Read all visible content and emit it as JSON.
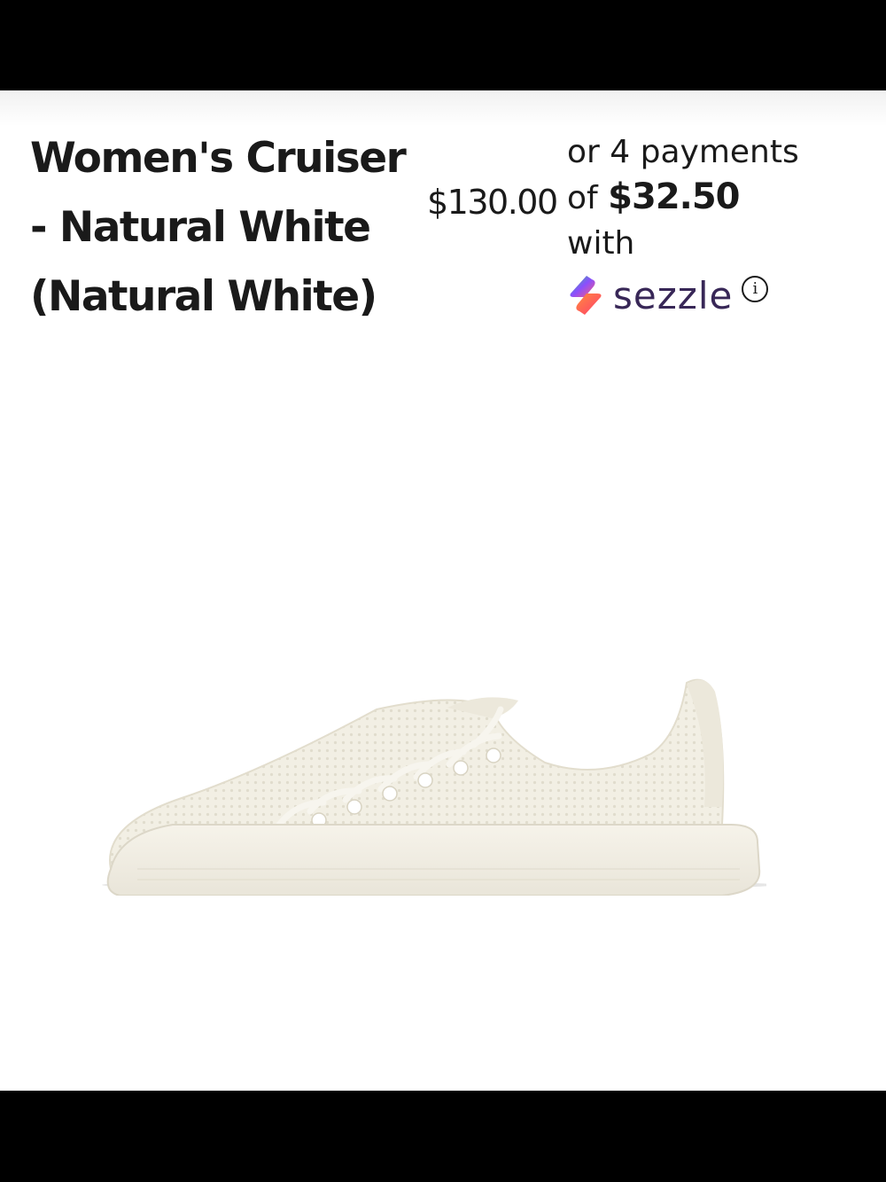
{
  "product": {
    "title": "Women's Cruiser - Natural White (Natural White)",
    "price": "$130.00"
  },
  "sezzle": {
    "line1": "or 4 payments",
    "of_label": "of",
    "installment": "$32.50",
    "with_label": "with",
    "brand": "sezzle",
    "info_glyph": "i",
    "brand_color": "#382757"
  },
  "image": {
    "icon": "sneaker-image"
  }
}
